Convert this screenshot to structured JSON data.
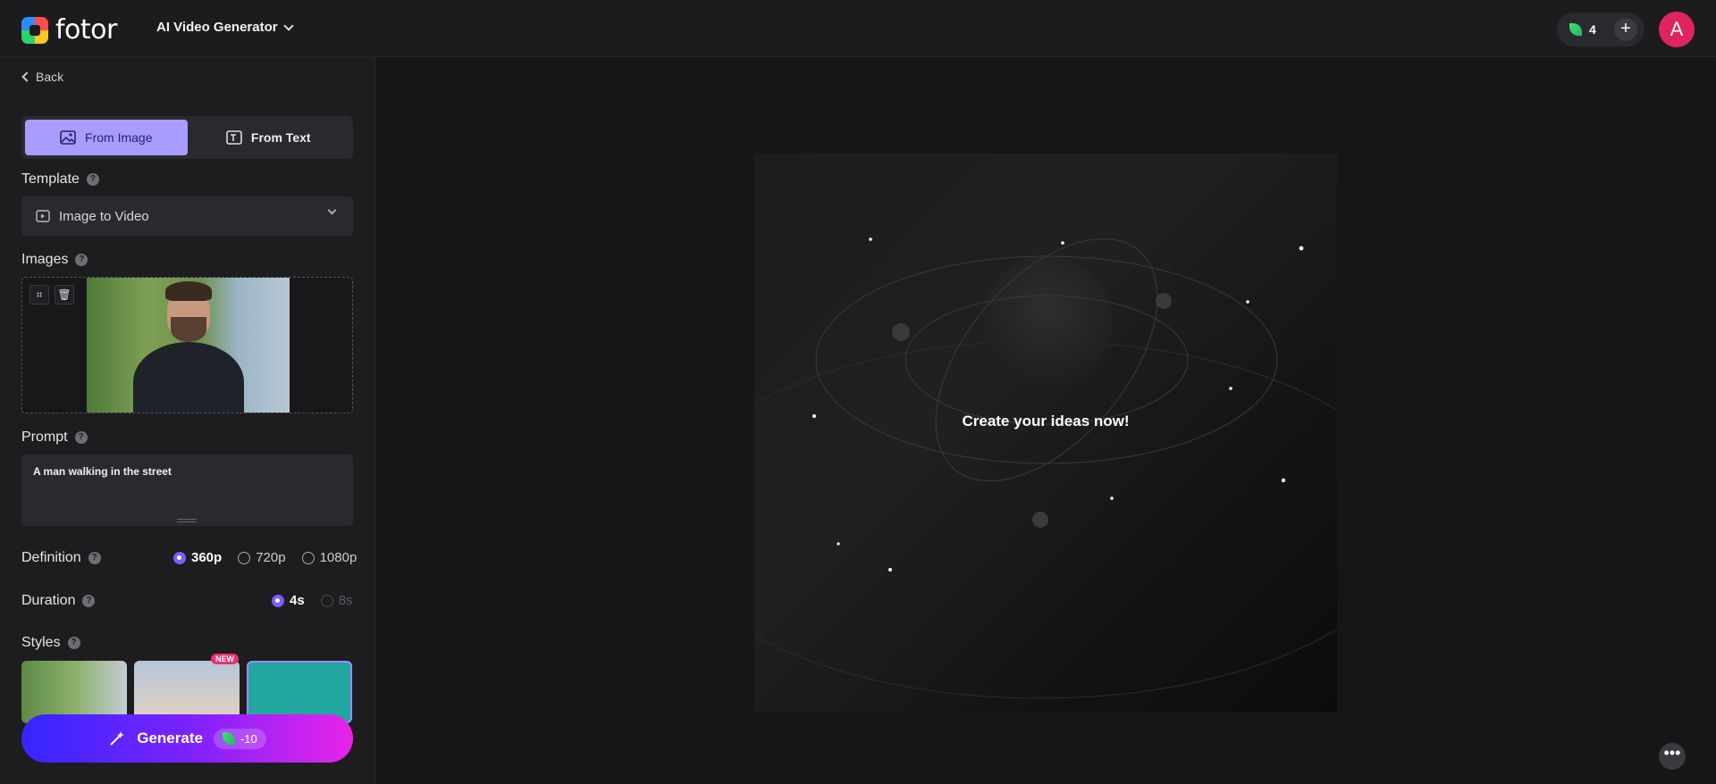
{
  "header": {
    "logo_text": "fotor",
    "product_name": "AI Video Generator",
    "credits": "4",
    "add_label": "+",
    "avatar_initial": "A"
  },
  "sidebar": {
    "back_label": "Back",
    "tabs": [
      {
        "label": "From Image",
        "active": true,
        "icon": "image-icon"
      },
      {
        "label": "From Text",
        "active": false,
        "icon": "text-image-icon"
      }
    ],
    "template": {
      "label": "Template",
      "help": "?",
      "value": "Image to Video"
    },
    "images": {
      "label": "Images",
      "help": "?"
    },
    "prompt": {
      "label": "Prompt",
      "help": "?",
      "value": "A man walking in the street"
    },
    "definition": {
      "label": "Definition",
      "help": "?",
      "options": [
        "360p",
        "720p",
        "1080p"
      ],
      "selected": "360p"
    },
    "duration": {
      "label": "Duration",
      "help": "?",
      "options": [
        "4s",
        "8s"
      ],
      "selected": "4s"
    },
    "styles": {
      "label": "Styles",
      "help": "?",
      "new_badge": "NEW"
    },
    "generate": {
      "label": "Generate",
      "cost": "-10"
    }
  },
  "stage": {
    "title": "Create your ideas now!"
  },
  "colors": {
    "accent": "#7a5cff",
    "tab_active": "#a99cff",
    "avatar": "#e0245e",
    "new_badge": "#e8336f"
  }
}
